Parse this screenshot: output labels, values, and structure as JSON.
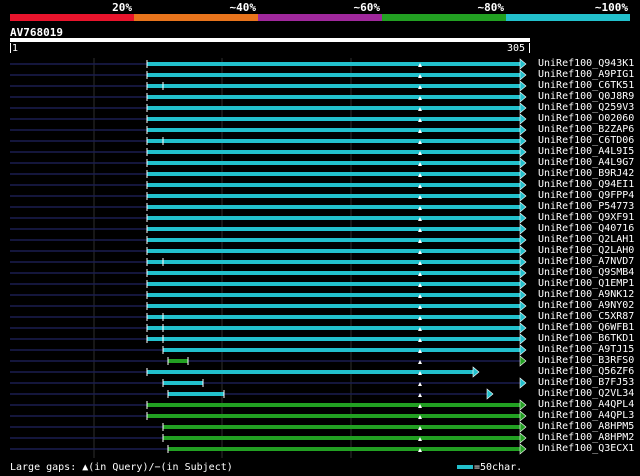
{
  "scale": {
    "labels": [
      "20%",
      "~40%",
      "~60%",
      "~80%",
      "~100%"
    ],
    "colors": [
      "#e8142c",
      "#e8741c",
      "#a0289c",
      "#22a022",
      "#22c0cc"
    ]
  },
  "query": {
    "id": "AV768019",
    "start": "1",
    "end": "305"
  },
  "colors": {
    "cyan": "#22c0cc",
    "green": "#22a022",
    "navy": "#1a1e50",
    "grid": "#2e2e2e",
    "bg": "#000000"
  },
  "hits": [
    {
      "name": "UniRef100_Q943K1",
      "color": "cyan"
    },
    {
      "name": "UniRef100_A9PIG1",
      "color": "cyan"
    },
    {
      "name": "UniRef100_C6TK51",
      "color": "cyan"
    },
    {
      "name": "UniRef100_Q0J8R9",
      "color": "cyan"
    },
    {
      "name": "UniRef100_Q259V3",
      "color": "cyan"
    },
    {
      "name": "UniRef100_O02060",
      "color": "cyan"
    },
    {
      "name": "UniRef100_B2ZAP6",
      "color": "cyan"
    },
    {
      "name": "UniRef100_C6TD06",
      "color": "cyan"
    },
    {
      "name": "UniRef100_A4L9I5",
      "color": "cyan"
    },
    {
      "name": "UniRef100_A4L9G7",
      "color": "cyan"
    },
    {
      "name": "UniRef100_B9RJ42",
      "color": "cyan"
    },
    {
      "name": "UniRef100_Q94EI1",
      "color": "cyan"
    },
    {
      "name": "UniRef100_Q9FPP4",
      "color": "cyan"
    },
    {
      "name": "UniRef100_P54773",
      "color": "cyan"
    },
    {
      "name": "UniRef100_Q9XF91",
      "color": "cyan"
    },
    {
      "name": "UniRef100_Q40716",
      "color": "cyan"
    },
    {
      "name": "UniRef100_Q2LAH1",
      "color": "cyan"
    },
    {
      "name": "UniRef100_Q2LAH0",
      "color": "cyan"
    },
    {
      "name": "UniRef100_A7NVD7",
      "color": "cyan"
    },
    {
      "name": "UniRef100_Q9SMB4",
      "color": "cyan"
    },
    {
      "name": "UniRef100_Q1EMP1",
      "color": "cyan"
    },
    {
      "name": "UniRef100_A9NK12",
      "color": "cyan"
    },
    {
      "name": "UniRef100_A9NY02",
      "color": "cyan"
    },
    {
      "name": "UniRef100_C5XR87",
      "color": "cyan"
    },
    {
      "name": "UniRef100_Q6WFB1",
      "color": "cyan"
    },
    {
      "name": "UniRef100_B6TKD1",
      "color": "cyan"
    },
    {
      "name": "UniRef100_A9TJ15",
      "color": "cyan"
    },
    {
      "name": "UniRef100_B3RFS0",
      "color": "green"
    },
    {
      "name": "UniRef100_Q56ZF6",
      "color": "cyan"
    },
    {
      "name": "UniRef100_B7FJ53",
      "color": "cyan"
    },
    {
      "name": "UniRef100_Q2VL34",
      "color": "cyan"
    },
    {
      "name": "UniRef100_A4QPL4",
      "color": "green"
    },
    {
      "name": "UniRef100_A4QPL3",
      "color": "green"
    },
    {
      "name": "UniRef100_A8HPM5",
      "color": "green"
    },
    {
      "name": "UniRef100_A8HPM2",
      "color": "green"
    },
    {
      "name": "UniRef100_Q3ECX1",
      "color": "green"
    }
  ],
  "legend": {
    "left": "Large gaps: ▲(in Query)/−(in Subject)",
    "right": "=50char."
  }
}
